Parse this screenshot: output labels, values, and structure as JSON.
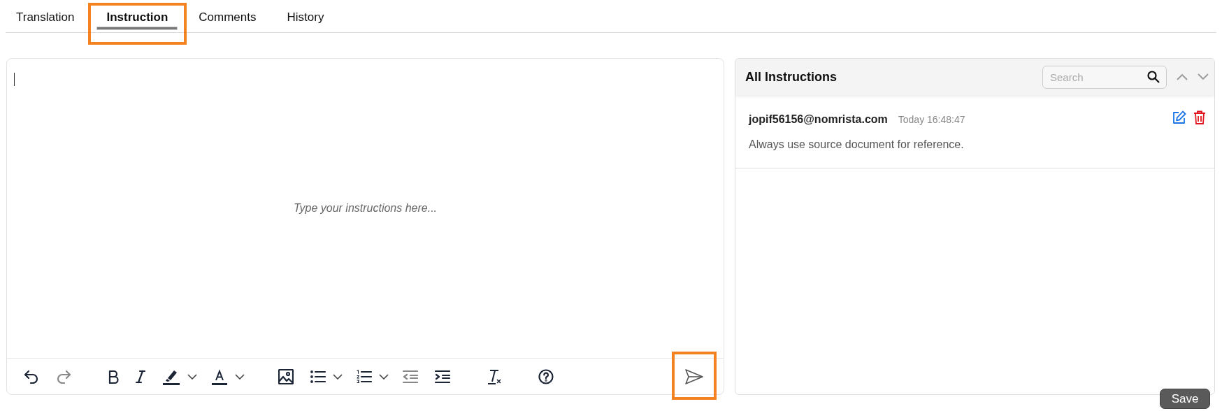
{
  "tabs": [
    {
      "label": "Translation",
      "selected": false,
      "highlighted": false
    },
    {
      "label": "Instruction",
      "selected": true,
      "highlighted": true
    },
    {
      "label": "Comments",
      "selected": false,
      "highlighted": false
    },
    {
      "label": "History",
      "selected": false,
      "highlighted": false
    }
  ],
  "editor": {
    "placeholder": "Type your instructions here...",
    "toolbar_groups": [
      [
        {
          "kind": "undo",
          "disabled": false
        },
        {
          "kind": "redo",
          "disabled": true
        }
      ],
      [
        {
          "kind": "bold",
          "disabled": false
        },
        {
          "kind": "italic",
          "disabled": false
        },
        {
          "kind": "highlight",
          "disabled": false
        },
        {
          "kind": "dropdown",
          "disabled": false
        },
        {
          "kind": "font-color",
          "disabled": false
        },
        {
          "kind": "dropdown",
          "disabled": false
        }
      ],
      [
        {
          "kind": "image",
          "disabled": false
        },
        {
          "kind": "bullet-list",
          "disabled": false
        },
        {
          "kind": "dropdown",
          "disabled": false
        },
        {
          "kind": "numbered-list",
          "disabled": false
        },
        {
          "kind": "dropdown",
          "disabled": false
        },
        {
          "kind": "outdent",
          "disabled": true
        },
        {
          "kind": "indent",
          "disabled": false
        }
      ],
      [
        {
          "kind": "clear-format",
          "disabled": false
        }
      ],
      [
        {
          "kind": "help",
          "disabled": false
        }
      ]
    ],
    "send": {
      "highlighted": true
    }
  },
  "instructions": {
    "title": "All Instructions",
    "search": {
      "placeholder": "Search"
    },
    "items": [
      {
        "author": "jopif56156@nomrista.com",
        "time": "Today 16:48:47",
        "text": "Always use source document for reference."
      }
    ]
  },
  "save_button": "Save"
}
